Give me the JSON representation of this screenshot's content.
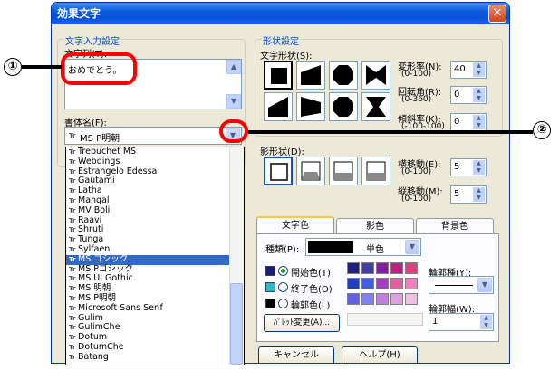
{
  "title": "効果文字",
  "close_glyph": "✕",
  "input_group": {
    "label": "文字入力設定",
    "text_label": "文字列(T):",
    "text_value": "おめでとう。"
  },
  "font_label": "書体名(F):",
  "font_value": "MS P明朝",
  "font_list": [
    "Trebuchet MS",
    "Webdings",
    "Estrangelo Edessa",
    "Gautami",
    "Latha",
    "Mangal",
    "MV Boli",
    "Raavi",
    "Shruti",
    "Tunga",
    "Sylfaen",
    "MS ゴシック",
    "MS Pゴシック",
    "MS UI Gothic",
    "MS 明朝",
    "MS P明朝",
    "Microsoft Sans Serif",
    "Gulim",
    "GulimChe",
    "Dotum",
    "DotumChe",
    "Batang"
  ],
  "selected_font": "MS ゴシック",
  "tt_glyph": "Tr",
  "shape_group": {
    "label": "形状設定",
    "shape_label": "文字形状(S):",
    "deform_label": "変形率(N):",
    "deform_range": "(0-100)",
    "deform_value": "40",
    "rotate_label": "回転角(R):",
    "rotate_range": "(0-360)",
    "rotate_value": "0",
    "tilt_label": "傾斜率(K):",
    "tilt_range": "(-100-100)",
    "tilt_value": "0"
  },
  "shadow_group": {
    "label": "影形状(D):",
    "hmove_label": "横移動(E):",
    "hmove_range": "(0-100)",
    "hmove_value": "5",
    "vmove_label": "縦移動(M):",
    "vmove_range": "(0-100)",
    "vmove_value": "5"
  },
  "tabs": [
    "文字色",
    "影色",
    "背景色"
  ],
  "color_panel": {
    "type_label": "種類(P):",
    "type_value": "単色",
    "start_label": "開始色(T)",
    "end_label": "終了色(O)",
    "outline_label": "輪郭色(L)",
    "outline_kind_label": "輪郭種(Y):",
    "outline_width_label": "輪郭幅(W):",
    "outline_width_value": "1",
    "palette_button": "ﾊﾟﾚｯﾄ変更(A)...",
    "start_color": "#1a1a7a",
    "end_color": "#2fb8c8",
    "outline_color": "#000000"
  },
  "buttons": {
    "cancel": "キャンセル",
    "help": "ヘルプ(H)"
  },
  "callouts": [
    "①",
    "②"
  ],
  "palette_colors": [
    "#202080",
    "#4040a0",
    "#8020a0",
    "#c02080",
    "#e04080",
    "#2040c0",
    "#4060e0",
    "#a040c0",
    "#e060a0",
    "#f080c0",
    "#6060e0",
    "#8080f0",
    "#c080e0",
    "#e0a0e0",
    "#f0c0e0"
  ]
}
